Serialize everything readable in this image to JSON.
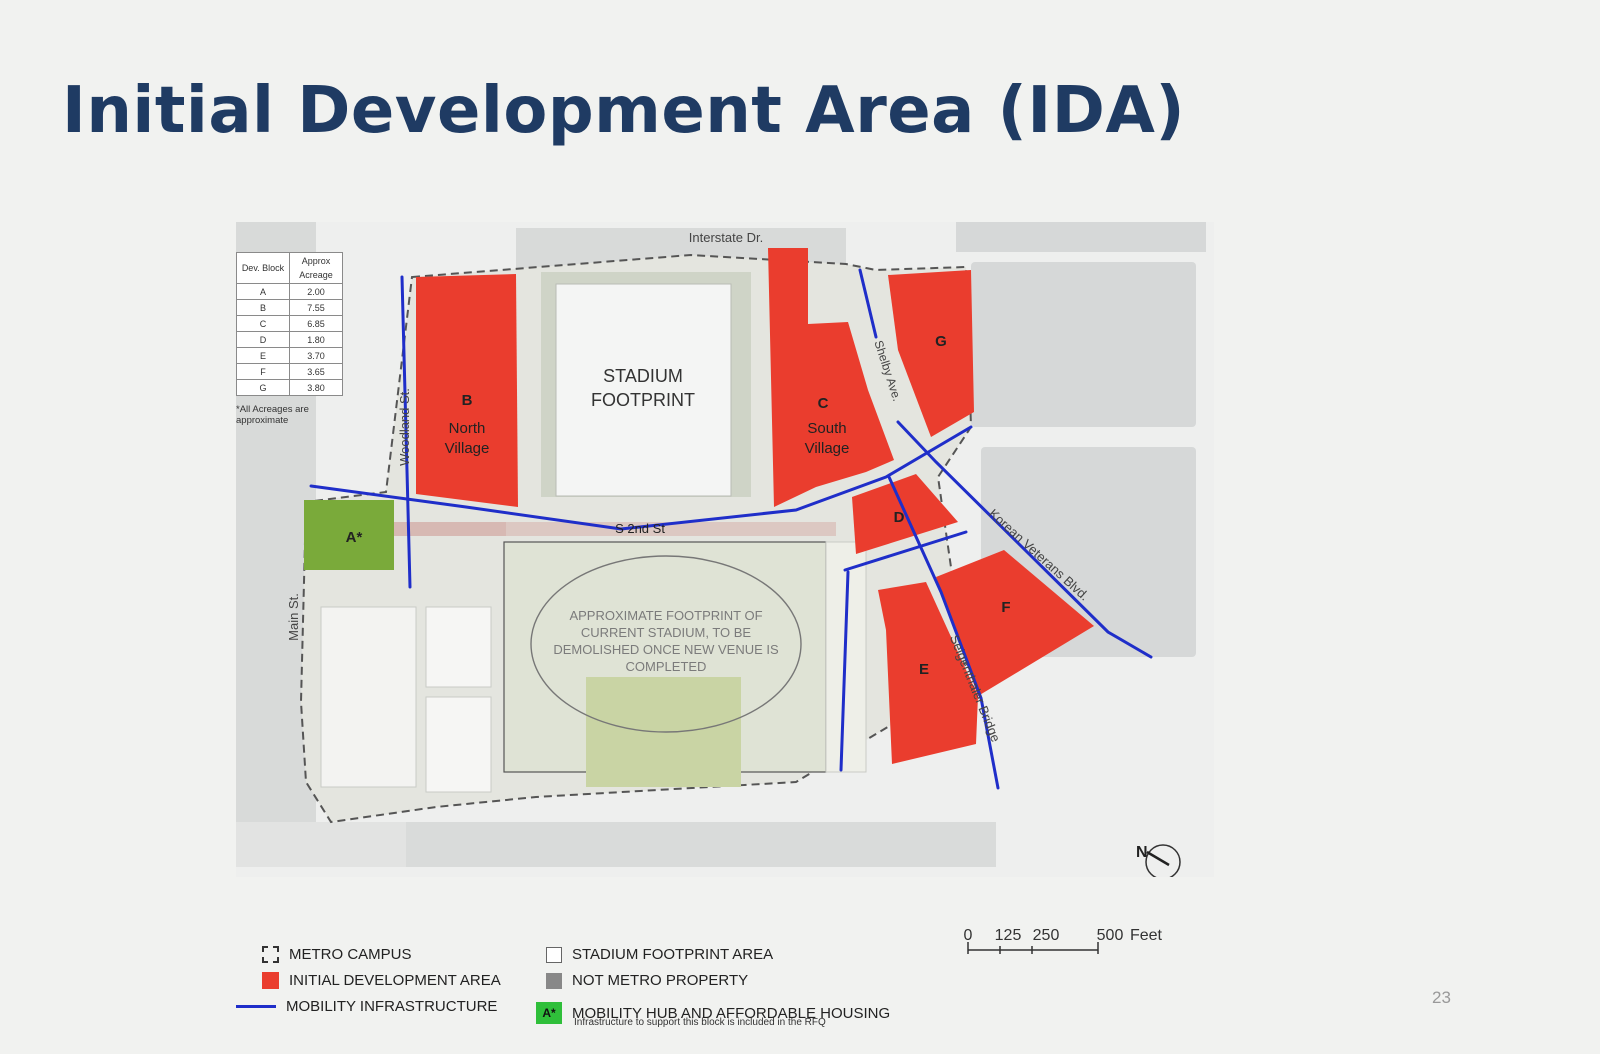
{
  "slide": {
    "title": "Initial Development Area (IDA)",
    "page_number": "23"
  },
  "acreage_table": {
    "headers": [
      "Dev. Block",
      "Approx Acreage"
    ],
    "rows": [
      [
        "A",
        "2.00"
      ],
      [
        "B",
        "7.55"
      ],
      [
        "C",
        "6.85"
      ],
      [
        "D",
        "1.80"
      ],
      [
        "E",
        "3.70"
      ],
      [
        "F",
        "3.65"
      ],
      [
        "G",
        "3.80"
      ]
    ],
    "note": "*All Acreages are approximate"
  },
  "map": {
    "streets": {
      "interstate_dr": "Interstate Dr.",
      "woodland_st": "Woodland St.",
      "s_2nd_st": "S 2nd St",
      "main_st": "Main St.",
      "shelby_ave": "Shelby Ave.",
      "korean_veterans_blvd": "Korean Veterans Blvd.",
      "seigenthaler_bridge": "Seigenthaler Bridge"
    },
    "stadium_label_line1": "STADIUM",
    "stadium_label_line2": "FOOTPRINT",
    "blocks": {
      "a": "A*",
      "b_letter": "B",
      "b_line1": "North",
      "b_line2": "Village",
      "c_letter": "C",
      "c_line1": "South",
      "c_line2": "Village",
      "d": "D",
      "e": "E",
      "f": "F",
      "g": "G"
    },
    "current_stadium_note": [
      "APPROXIMATE FOOTPRINT OF",
      "CURRENT STADIUM, TO BE",
      "DEMOLISHED ONCE NEW VENUE IS",
      "COMPLETED"
    ],
    "north_label": "N",
    "colors": {
      "ida_red": "#ea3d2e",
      "mobility_hub_green": "#7aaa3a",
      "infrastructure_blue": "#1f2ec9",
      "not_metro_gray": "#d3d6d6"
    }
  },
  "scale": {
    "ticks": [
      "0",
      "125",
      "250",
      "500"
    ],
    "unit": "Feet"
  },
  "legend": {
    "metro_campus": "METRO CAMPUS",
    "ida": "INITIAL DEVELOPMENT AREA",
    "mobility": "MOBILITY INFRASTRUCTURE",
    "stadium_area": "STADIUM FOOTPRINT AREA",
    "not_metro": "NOT METRO PROPERTY",
    "hub": "MOBILITY HUB AND AFFORDABLE HOUSING",
    "hub_swatch_label": "A*",
    "hub_note": "Infrastructure to support this block is included in the RFQ"
  }
}
